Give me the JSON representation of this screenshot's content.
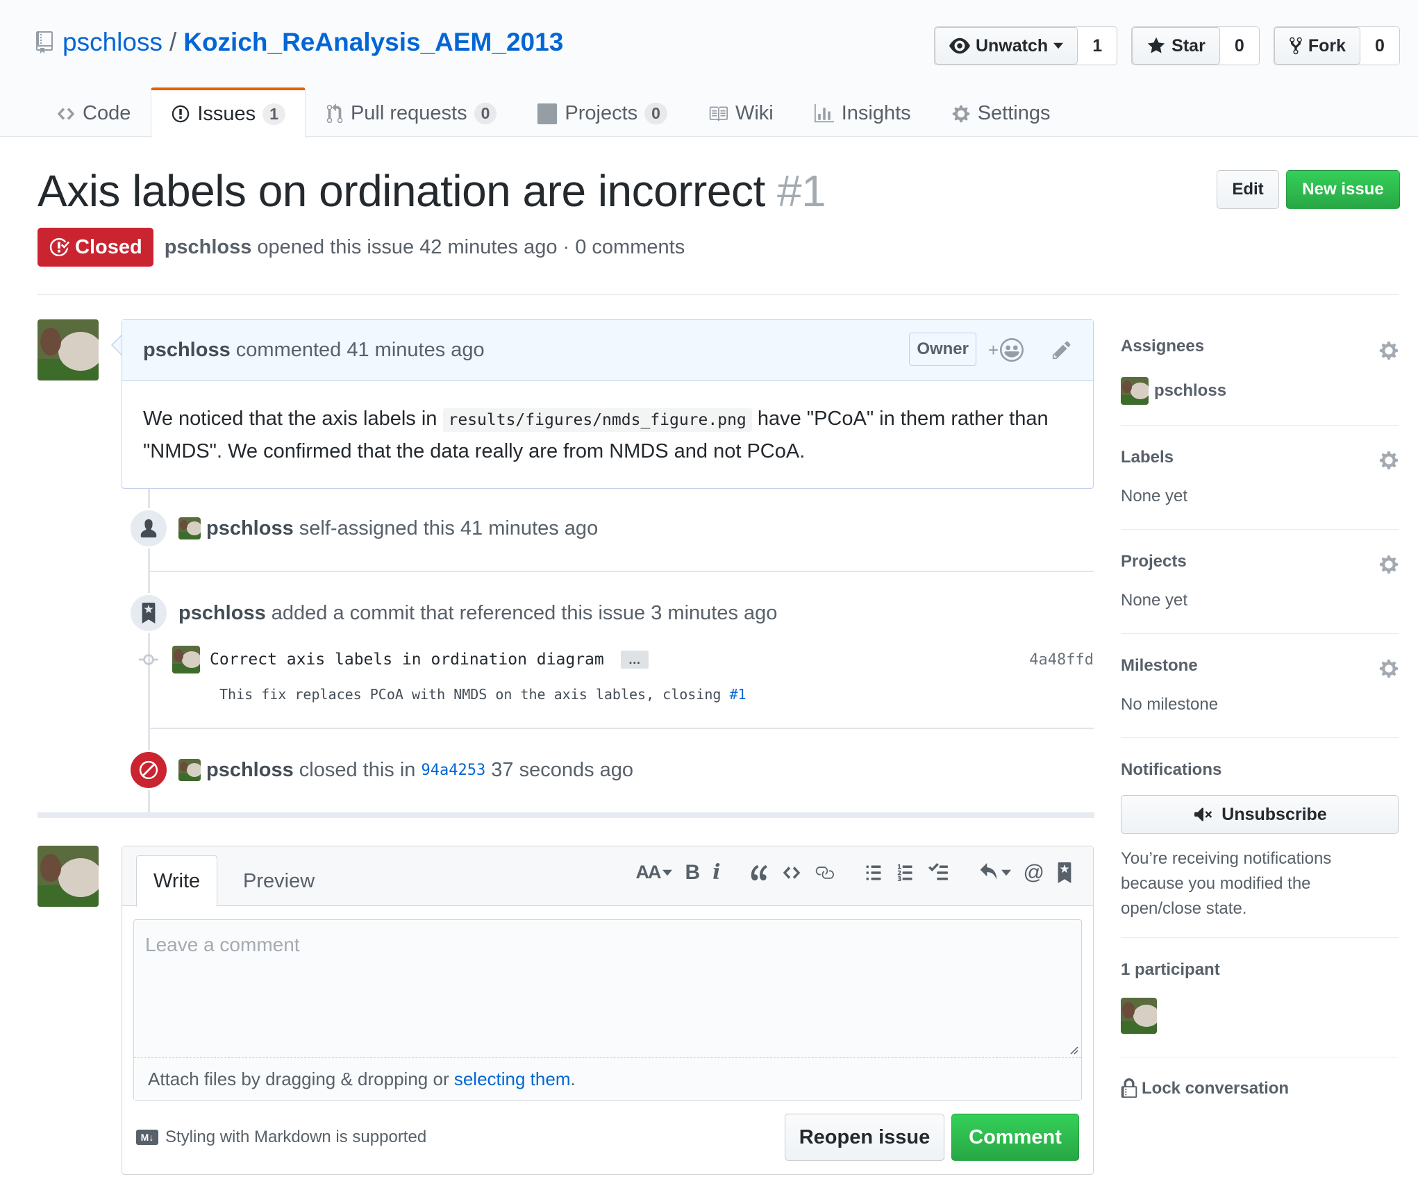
{
  "repo": {
    "owner": "pschloss",
    "separator": "/",
    "name": "Kozich_ReAnalysis_AEM_2013"
  },
  "actions": {
    "watch": {
      "label": "Unwatch",
      "count": "1"
    },
    "star": {
      "label": "Star",
      "count": "0"
    },
    "fork": {
      "label": "Fork",
      "count": "0"
    }
  },
  "nav": {
    "code": {
      "label": "Code"
    },
    "issues": {
      "label": "Issues",
      "count": "1"
    },
    "pulls": {
      "label": "Pull requests",
      "count": "0"
    },
    "projects": {
      "label": "Projects",
      "count": "0"
    },
    "wiki": {
      "label": "Wiki"
    },
    "insights": {
      "label": "Insights"
    },
    "settings": {
      "label": "Settings"
    }
  },
  "issue": {
    "title": "Axis labels on ordination are incorrect",
    "number": "#1",
    "state": "Closed",
    "author": "pschloss",
    "meta": "opened this issue 42 minutes ago · 0 comments",
    "edit_label": "Edit",
    "new_issue_label": "New issue"
  },
  "comment": {
    "author": "pschloss",
    "time": "commented 41 minutes ago",
    "role": "Owner",
    "reaction": "+",
    "body_before": "We noticed that the axis labels in",
    "code": "results/figures/nmds_figure.png",
    "body_after": "have \"PCoA\" in them rather than \"NMDS\". We confirmed that the data really are from NMDS and not PCoA."
  },
  "events": {
    "assigned": {
      "author": "pschloss",
      "text": "self-assigned this 41 minutes ago"
    },
    "commit_ref": {
      "author": "pschloss",
      "text": "added a commit that referenced this issue 3 minutes ago"
    },
    "commit": {
      "title": "Correct axis labels in ordination diagram",
      "ellipsis": "…",
      "sha": "4a48ffd",
      "desc": "This fix replaces PCoA with NMDS on the axis lables, closing",
      "ref": "#1"
    },
    "closed": {
      "author": "pschloss",
      "text_before": "closed this in",
      "sha": "94a4253",
      "text_after": "37 seconds ago"
    }
  },
  "new_comment": {
    "tab_write": "Write",
    "tab_preview": "Preview",
    "toolbar": {
      "heading": "AA",
      "bold": "B",
      "italic": "i",
      "mention": "@"
    },
    "placeholder": "Leave a comment",
    "attach_before": "Attach files by dragging & dropping or ",
    "attach_link": "selecting them",
    "attach_after": ".",
    "markdown_note": "Styling with Markdown is supported",
    "md_badge": "M↓",
    "reopen_label": "Reopen issue",
    "comment_label": "Comment"
  },
  "sidebar": {
    "assignees": {
      "heading": "Assignees",
      "value": "pschloss"
    },
    "labels": {
      "heading": "Labels",
      "value": "None yet"
    },
    "projects": {
      "heading": "Projects",
      "value": "None yet"
    },
    "milestone": {
      "heading": "Milestone",
      "value": "No milestone"
    },
    "notifications": {
      "heading": "Notifications",
      "button": "Unsubscribe",
      "reason": "You’re receiving notifications because you modified the open/close state."
    },
    "participants": {
      "heading": "1 participant"
    },
    "lock": "Lock conversation"
  },
  "colors": {
    "accent_orange": "#e36209",
    "closed_red": "#cb2431",
    "primary_green": "#28a745",
    "link_blue": "#0366d6"
  }
}
